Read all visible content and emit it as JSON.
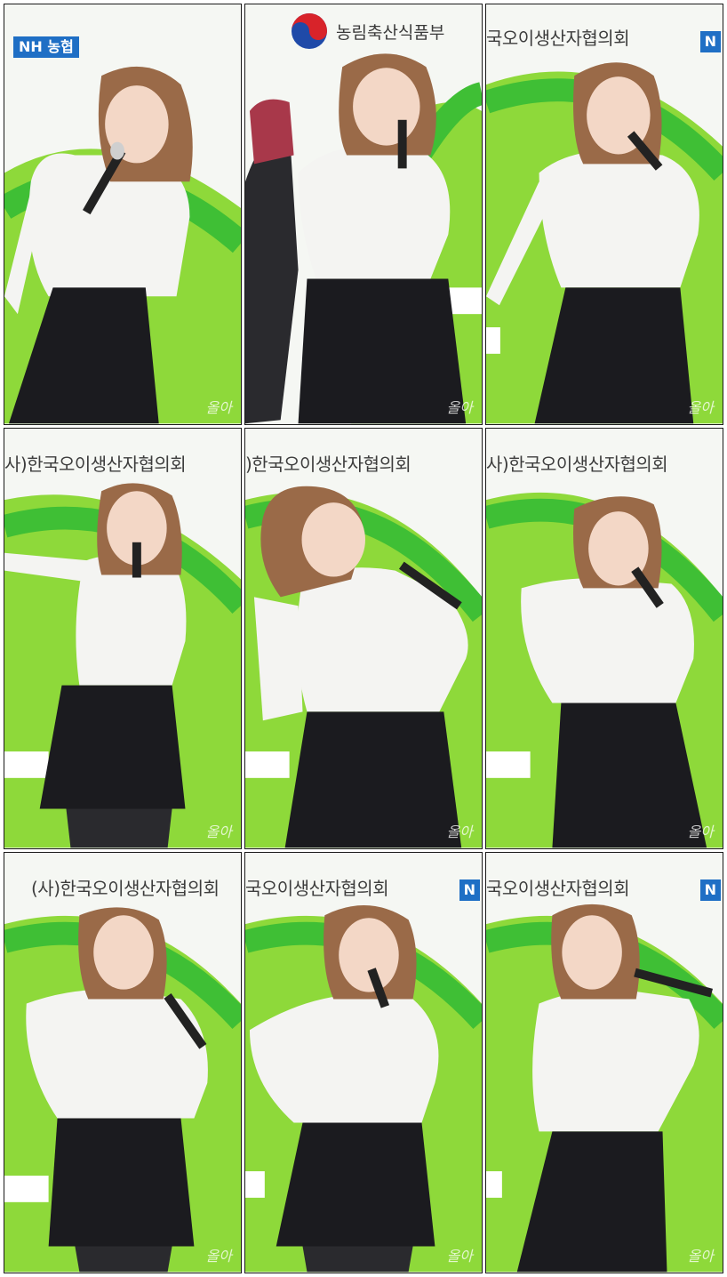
{
  "collage": {
    "tiles": [
      {
        "id": 1,
        "banner": "",
        "logo": "NH 농협",
        "watermark": "올아"
      },
      {
        "id": 2,
        "banner": "농림축산식품부",
        "logo": "",
        "watermark": "올아"
      },
      {
        "id": 3,
        "banner": "국오이생산자협의회",
        "logo": "N",
        "watermark": "올아"
      },
      {
        "id": 4,
        "banner": "사)한국오이생산자협의회",
        "logo": "",
        "watermark": "올아"
      },
      {
        "id": 5,
        "banner": ")한국오이생산자협의회",
        "logo": "",
        "watermark": "올아"
      },
      {
        "id": 6,
        "banner": "사)한국오이생산자협의회",
        "logo": "",
        "watermark": "올아"
      },
      {
        "id": 7,
        "banner": "(사)한국오이생산자협의회",
        "logo": "",
        "watermark": "올아"
      },
      {
        "id": 8,
        "banner": "국오이생산자협의회",
        "logo": "N",
        "watermark": "올아"
      },
      {
        "id": 9,
        "banner": "국오이생산자협의회",
        "logo": "N",
        "watermark": "올아"
      }
    ]
  },
  "colors": {
    "background_green": "#8ed93a",
    "ring_green": "#3fbf35",
    "shirt": "#f4f4f2",
    "skirt": "#1b1b1f",
    "hair": "#9a6a48"
  }
}
